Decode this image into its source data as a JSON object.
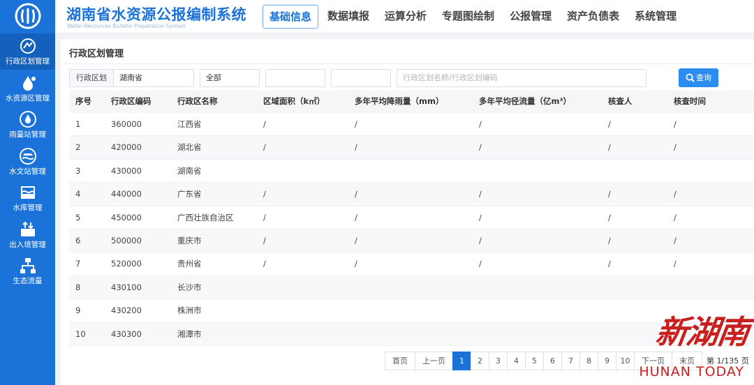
{
  "app": {
    "title": "湖南省水资源公报编制系统",
    "subtitle": "Water Resources Bulletin Preparation System"
  },
  "top_menu": [
    "基础信息",
    "数据填报",
    "运算分析",
    "专题图绘制",
    "公报管理",
    "资产负债表",
    "系统管理"
  ],
  "sidebar": {
    "items": [
      {
        "label": "行政区划管理",
        "icon": "admin-division-icon"
      },
      {
        "label": "水资源区管理",
        "icon": "water-resource-zone-icon"
      },
      {
        "label": "雨量站管理",
        "icon": "rain-station-icon"
      },
      {
        "label": "水文站管理",
        "icon": "hydrology-station-icon"
      },
      {
        "label": "水库管理",
        "icon": "reservoir-icon"
      },
      {
        "label": "出入境管理",
        "icon": "inflow-outflow-icon"
      },
      {
        "label": "生态流量",
        "icon": "ecological-flow-icon"
      }
    ]
  },
  "page": {
    "title": "行政区划管理"
  },
  "filters": {
    "label": "行政区划",
    "province_value": "湖南省",
    "level_value": "全部",
    "field3_value": "",
    "field4_value": "",
    "search_placeholder": "行政区划名称/行政区划编码",
    "query_label": "查询"
  },
  "table": {
    "headers": [
      "序号",
      "行政区编码",
      "行政区名称",
      "区域面积（k㎡）",
      "多年平均降雨量（mm）",
      "多年平均径流量（亿m³）",
      "核查人",
      "核查时间"
    ],
    "rows": [
      [
        "1",
        "360000",
        "江西省",
        "/",
        "/",
        "/",
        "/",
        "/"
      ],
      [
        "2",
        "420000",
        "湖北省",
        "/",
        "/",
        "/",
        "/",
        "/"
      ],
      [
        "3",
        "430000",
        "湖南省",
        "",
        "",
        "",
        "",
        ""
      ],
      [
        "4",
        "440000",
        "广东省",
        "/",
        "/",
        "/",
        "/",
        "/"
      ],
      [
        "5",
        "450000",
        "广西壮族自治区",
        "/",
        "/",
        "/",
        "/",
        "/"
      ],
      [
        "6",
        "500000",
        "重庆市",
        "/",
        "/",
        "/",
        "/",
        "/"
      ],
      [
        "7",
        "520000",
        "贵州省",
        "/",
        "/",
        "/",
        "/",
        "/"
      ],
      [
        "8",
        "430100",
        "长沙市",
        "",
        "",
        "",
        "",
        ""
      ],
      [
        "9",
        "430200",
        "株洲市",
        "",
        "",
        "",
        "",
        ""
      ],
      [
        "10",
        "430300",
        "湘潭市",
        "",
        "",
        "",
        "",
        ""
      ]
    ]
  },
  "pagination": {
    "first": "首页",
    "prev": "上一页",
    "pages": [
      "1",
      "2",
      "3",
      "4",
      "5",
      "6",
      "7",
      "8",
      "9",
      "10"
    ],
    "current": "1",
    "next": "下一页",
    "last": "末页",
    "info": "第 1/135 页"
  },
  "watermark": {
    "top": "新湖南",
    "bottom": "HUNAN TODAY"
  },
  "colors": {
    "primary": "#1b73d9",
    "sidebar_active": "#1460bd",
    "watermark": "#c8201f"
  }
}
